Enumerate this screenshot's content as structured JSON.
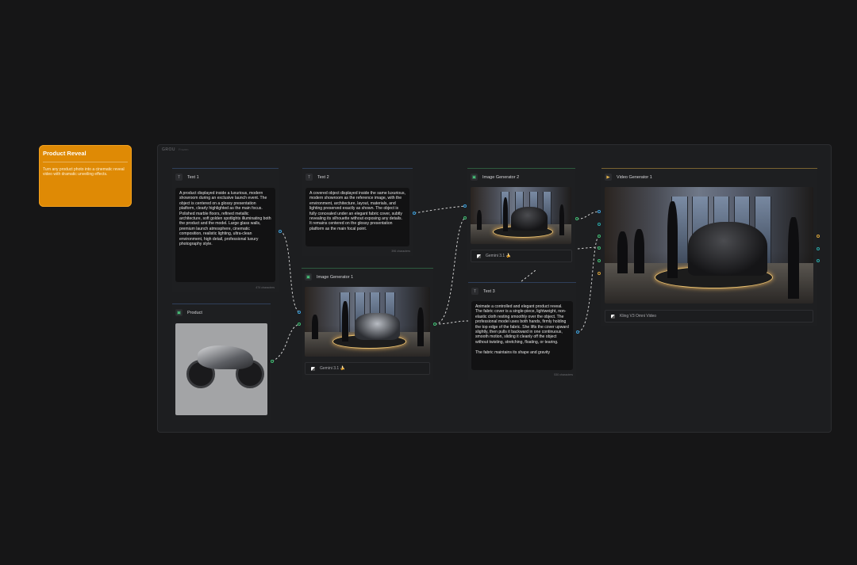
{
  "sticky_note": {
    "title": "Product Reveal",
    "body": "Turn any product photo into a cinematic reveal video with dramatic unveiling effects."
  },
  "group": {
    "label": "GROU",
    "sublabel": "Frozen"
  },
  "nodes": {
    "text1": {
      "title": "Text 1",
      "content": "A product displayed inside a luxurious, modern showroom during an exclusive launch event. The object is centered on a glossy presentation platform, clearly highlighted as the main focus. Polished marble floors, refined metallic architecture, soft golden spotlights illuminating both the product and the model. Large glass walls, premium launch atmosphere, cinematic composition, realistic lighting, ultra-clean environment, high detail, professional luxury photography style.",
      "char_count": "474 characters"
    },
    "text2": {
      "title": "Text 2",
      "content": "A covered object displayed inside the same luxurious, modern showroom as the reference image, with the environment, architecture, layout, materials, and lighting preserved exactly as shown. The object is fully concealed under an elegant fabric cover, subtly revealing its silhouette without exposing any details. It remains centered on the glossy presentation platform as the main focal point.",
      "char_count": "396 characters"
    },
    "text3": {
      "title": "Text 3",
      "content": "Animate a controlled and elegant product reveal. The fabric cover is a single-piece, lightweight, non-elastic cloth resting smoothly over the object. The professional model uses both hands, firmly holding the top edge of the fabric. She lifts the cover upward slightly, then pulls it backward in one continuous, smooth motion, sliding it cleanly off the object without twisting, stretching, floating, or tearing.\n\nThe fabric maintains its shape and gravity",
      "char_count": "530 characters"
    },
    "product": {
      "title": "Product"
    },
    "image_gen_1": {
      "title": "Image Generator 1",
      "model": "Gemini 3.1 🍌"
    },
    "image_gen_2": {
      "title": "Image Generator 2",
      "model": "Gemini 3.1 🍌"
    },
    "video_gen_1": {
      "title": "Video Generator 1",
      "model": "Kling V3 Omni Video"
    }
  },
  "colors": {
    "background": "#161617",
    "note": "#df8a05",
    "port_text": "#3ca0dc",
    "port_image": "#3fbf74",
    "port_video": "#d9a33a"
  },
  "icons": {
    "text_node": "text-icon",
    "image_node": "image-icon",
    "product_node": "image-upload-icon",
    "video_node": "video-icon",
    "model": "gemini-logo-icon"
  }
}
